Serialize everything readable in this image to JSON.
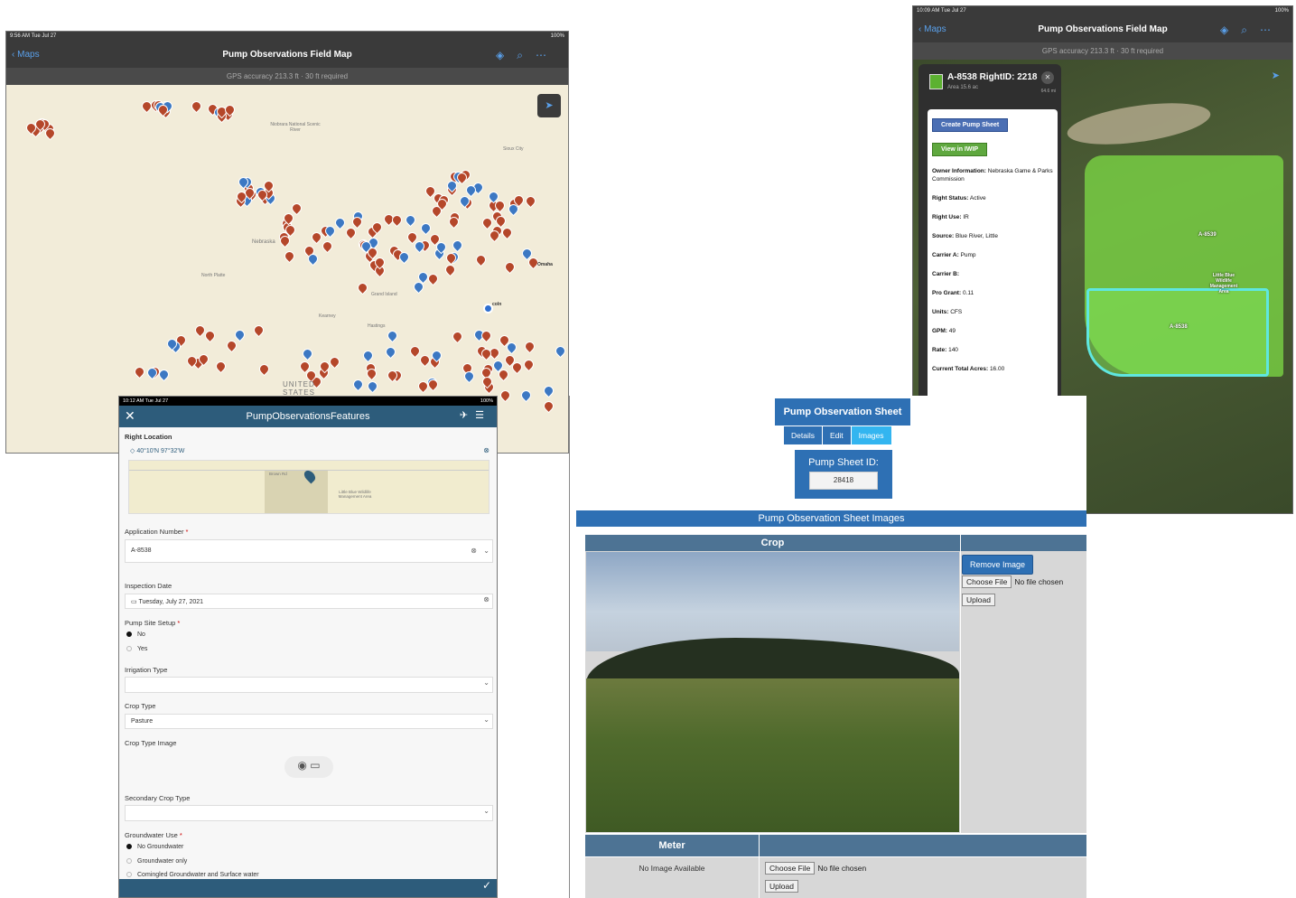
{
  "map_panel": {
    "time": "9:56 AM  Tue Jul 27",
    "battery": "100%",
    "back_label": "Maps",
    "title": "Pump Observations Field Map",
    "gps_text": "GPS accuracy 213.3 ft  ·  30 ft required",
    "place_labels": [
      "Niobrara National Scenic River",
      "Nebraska",
      "North Platte",
      "Grand Island",
      "Kearney",
      "Hastings",
      "Omaha",
      "Sioux City",
      "UNITED STATES",
      "coln"
    ]
  },
  "satellite_panel": {
    "time": "10:09 AM  Tue Jul 27",
    "battery": "100%",
    "back_label": "Maps",
    "title": "Pump Observations Field Map",
    "gps_text": "GPS accuracy 213.3 ft  ·  30 ft required",
    "popup": {
      "title": "A-8538 RightID: 2218",
      "subtitle": "Area 15.6 ac",
      "distance": "64.6 mi",
      "create_button": "Create Pump Sheet",
      "view_button": "View in IWIP",
      "fields": [
        {
          "label": "Owner Information:",
          "value": "Nebraska Game & Parks Commission"
        },
        {
          "label": "Right Status:",
          "value": "Active"
        },
        {
          "label": "Right Use:",
          "value": "IR"
        },
        {
          "label": "Source:",
          "value": "Blue River, Little"
        },
        {
          "label": "Carrier A:",
          "value": "Pump"
        },
        {
          "label": "Carrier B:",
          "value": ""
        },
        {
          "label": "Pro Grant:",
          "value": "0.11"
        },
        {
          "label": "Units:",
          "value": "CFS"
        },
        {
          "label": "GPM:",
          "value": "49"
        },
        {
          "label": "Rate:",
          "value": "140"
        },
        {
          "label": "Current Total Acres:",
          "value": "16.00"
        }
      ]
    },
    "field_labels": [
      "A-8539",
      "A-8538",
      "Little Blue Wildlife Management Area"
    ]
  },
  "form_panel": {
    "time": "10:12 AM  Tue Jul 27",
    "battery": "100%",
    "title": "PumpObservationsFeatures",
    "right_location_label": "Right Location",
    "right_location_value": "40°10'N 97°32'W",
    "minimap_labels": [
      "Little Blue Wildlife Management Area",
      "Brown Rd"
    ],
    "application_number_label": "Application Number",
    "application_number_value": "A-8538",
    "inspection_date_label": "Inspection Date",
    "inspection_date_value": "Tuesday, July 27, 2021",
    "pump_site_label": "Pump Site Setup",
    "pump_site_options": [
      "No",
      "Yes"
    ],
    "irrigation_type_label": "Irrigation Type",
    "crop_type_label": "Crop Type",
    "crop_type_value": "Pasture",
    "crop_image_label": "Crop Type Image",
    "secondary_crop_label": "Secondary Crop Type",
    "groundwater_label": "Groundwater Use",
    "groundwater_options": [
      "No Groundwater",
      "Groundwater only",
      "Comingled Groundwater and Surface water"
    ],
    "required_mark": "*"
  },
  "web_panel": {
    "title": "Pump Observation Sheet",
    "tabs": [
      "Details",
      "Edit",
      "Images"
    ],
    "active_tab": "Images",
    "sheet_id_label": "Pump Sheet ID:",
    "sheet_id_value": "28418",
    "images_header": "Pump Observation Sheet Images",
    "crop_header": "Crop",
    "meter_header": "Meter",
    "remove_image": "Remove Image",
    "choose_file": "Choose File",
    "no_file": "No file chosen",
    "upload": "Upload",
    "no_image": "No Image Available"
  }
}
